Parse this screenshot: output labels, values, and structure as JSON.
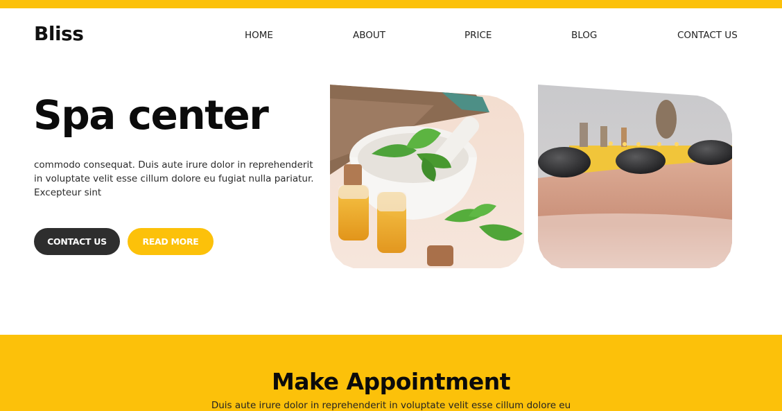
{
  "header": {
    "brand": "Bliss",
    "nav": [
      "HOME",
      "ABOUT",
      "PRICE",
      "BLOG",
      "CONTACT US"
    ]
  },
  "hero": {
    "title": "Spa center",
    "text": "commodo consequat. Duis aute irure dolor in reprehenderit in voluptate velit esse cillum dolore eu fugiat nulla pariatur. Excepteur sint",
    "contact_button": "CONTACT US",
    "read_more_button": "READ MORE"
  },
  "gallery": {
    "images": [
      "herbs-mortar-oil-photo",
      "hot-stone-massage-photo"
    ]
  },
  "appointment": {
    "title": "Make Appointment",
    "text": "Duis aute irure dolor in reprehenderit in voluptate velit esse cillum dolore eu"
  },
  "colors": {
    "accent": "#fcc10a",
    "dark_button": "#2e2e2e",
    "text": "#0b0b0b"
  }
}
